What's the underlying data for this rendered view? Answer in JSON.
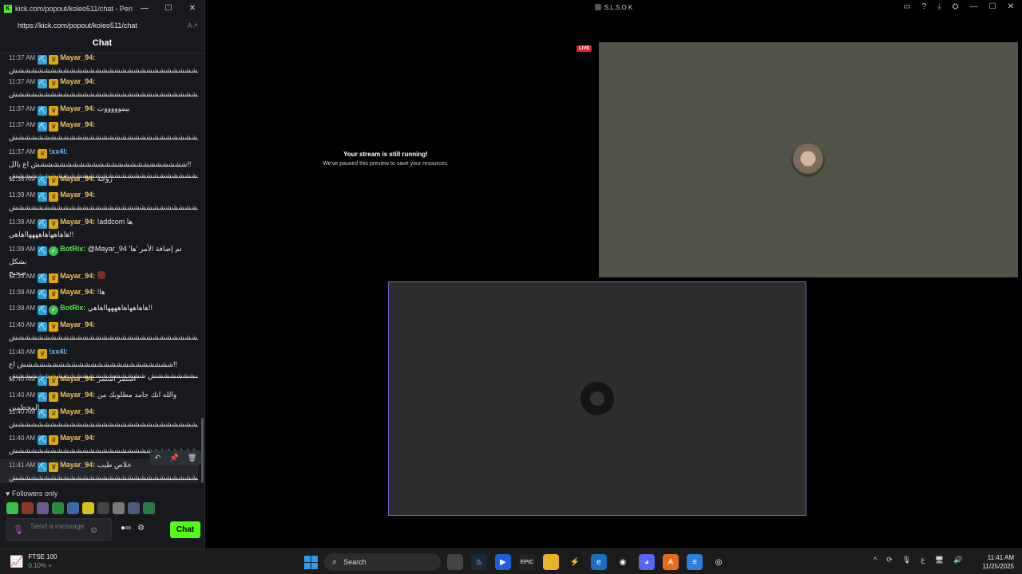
{
  "browser": {
    "window_title": "kick.com/popout/koleo511/chat - Perso...",
    "favicon": "K",
    "url": "https://kick.com/popout/koleo511/chat",
    "reader_icon": "A↗",
    "controls": {
      "minimize": "—",
      "maximize": "☐",
      "close": "✕"
    }
  },
  "chat": {
    "header": "Chat",
    "messages": [
      {
        "time": "11:37 AM",
        "user": "Mayar_94",
        "user_color": "gold",
        "badges": [
          "pick",
          "crown"
        ],
        "text": "",
        "line2": "ششششششششششششششششششششششششششششششششششششششششش"
      },
      {
        "time": "11:37 AM",
        "user": "Mayar_94",
        "user_color": "gold",
        "badges": [
          "pick",
          "crown"
        ],
        "text": "",
        "line2": "ششششششششششششششششششششششششششششششششششششششششش"
      },
      {
        "time": "11:37 AM",
        "user": "Mayar_94",
        "user_color": "gold",
        "badges": [
          "pick",
          "crown"
        ],
        "text": "بيموووووت",
        "line2": ""
      },
      {
        "time": "11:37 AM",
        "user": "Mayar_94",
        "user_color": "gold",
        "badges": [
          "pick",
          "crown"
        ],
        "text": "",
        "line2": "ششششششششششششششششششششششششششششششششششششششششش"
      },
      {
        "time": "11:37 AM",
        "user": "!xx4l",
        "user_color": "blue",
        "badges": [
          "crown"
        ],
        "text": "شششششششششششششششششششششششش اع يالل!!",
        "line2": "ششششششششششششششششششششششششششششششششششش"
      },
      {
        "time": "11:38 AM",
        "user": "Mayar_94",
        "user_color": "gold",
        "badges": [
          "pick",
          "crown"
        ],
        "text": "زوجه",
        "line2": ""
      },
      {
        "time": "11:39 AM",
        "user": "Mayar_94",
        "user_color": "gold",
        "badges": [
          "pick",
          "crown"
        ],
        "text": "",
        "line2": "ششششششششششششششششششششششششششششششششششششششششش"
      },
      {
        "time": "11:39 AM",
        "user": "Mayar_94",
        "user_color": "gold",
        "badges": [
          "pick",
          "crown"
        ],
        "text": "!addcom ها",
        "line2": "هاهاههاهاههههااهاهي!!"
      },
      {
        "time": "11:39 AM",
        "user": "BotRix",
        "user_color": "green",
        "badges": [
          "pick",
          "check"
        ],
        "text": "@Mayar_94 تم إضافة الأمر 'ها' بشكل",
        "line2": "صحيح."
      },
      {
        "time": "11:39 AM",
        "user": "Mayar_94",
        "user_color": "gold",
        "badges": [
          "pick",
          "crown"
        ],
        "text": "",
        "line2": "",
        "emote": true
      },
      {
        "time": "11:39 AM",
        "user": "Mayar_94",
        "user_color": "gold",
        "badges": [
          "pick",
          "crown"
        ],
        "text": "!ها",
        "line2": ""
      },
      {
        "time": "11:39 AM",
        "user": "BotRix",
        "user_color": "green",
        "badges": [
          "pick",
          "check"
        ],
        "text": "هاهاههاهاههههااهاهي!!",
        "line2": ""
      },
      {
        "time": "11:40 AM",
        "user": "Mayar_94",
        "user_color": "gold",
        "badges": [
          "pick",
          "crown"
        ],
        "text": "",
        "line2": "ششششششششششششششششششششششششششششششششششششششششش"
      },
      {
        "time": "11:40 AM",
        "user": "!xx4l",
        "user_color": "blue",
        "badges": [
          "crown"
        ],
        "text": "شششششششششششششششششششششششش اع!!",
        "line2": "شششششششششششششششششششششششششش ششششششششششششششششششششش"
      },
      {
        "time": "11:40 AM",
        "user": "Mayar_94",
        "user_color": "gold",
        "badges": [
          "pick",
          "crown"
        ],
        "text": "استمر استمر",
        "line2": ""
      },
      {
        "time": "11:40 AM",
        "user": "Mayar_94",
        "user_color": "gold",
        "badges": [
          "pick",
          "crown"
        ],
        "text": "والله انك جامد مطلوبك من المحطمين",
        "line2": ""
      },
      {
        "time": "11:40 AM",
        "user": "Mayar_94",
        "user_color": "gold",
        "badges": [
          "pick",
          "crown"
        ],
        "text": "",
        "line2": "ششششششششششششششششششششششششششششششششششششششششش"
      },
      {
        "time": "11:40 AM",
        "user": "Mayar_94",
        "user_color": "gold",
        "badges": [
          "pick",
          "crown"
        ],
        "text": "",
        "line2": "ششششششششششششششششششششششششششششششششششششششششش"
      },
      {
        "time": "11:41 AM",
        "user": "Mayar_94",
        "user_color": "gold",
        "badges": [
          "pick",
          "crown"
        ],
        "text": "خلاص طيب",
        "line2": "ششششششششششششششششششششششششششششششششششششششششش",
        "hover": true
      }
    ],
    "followers_only": "♥ Followers only",
    "input_placeholder": "Send a message",
    "send_label": "Chat"
  },
  "obs": {
    "window_title": "S.L.S.O.K",
    "live_label": "LIVE",
    "paused_title": "Your stream is still running!",
    "paused_subtitle": "We've paused this preview to save your resources."
  },
  "taskbar": {
    "stock_name": "FTSE 100",
    "stock_change": "0.10% +",
    "search_label": "Search",
    "lang": "ع",
    "time": "11:41 AM",
    "date": "11/25/2025"
  },
  "colors": {
    "kick_green": "#53fc18",
    "live_red": "#e0262b",
    "selection_border": "#6d6ad8"
  }
}
